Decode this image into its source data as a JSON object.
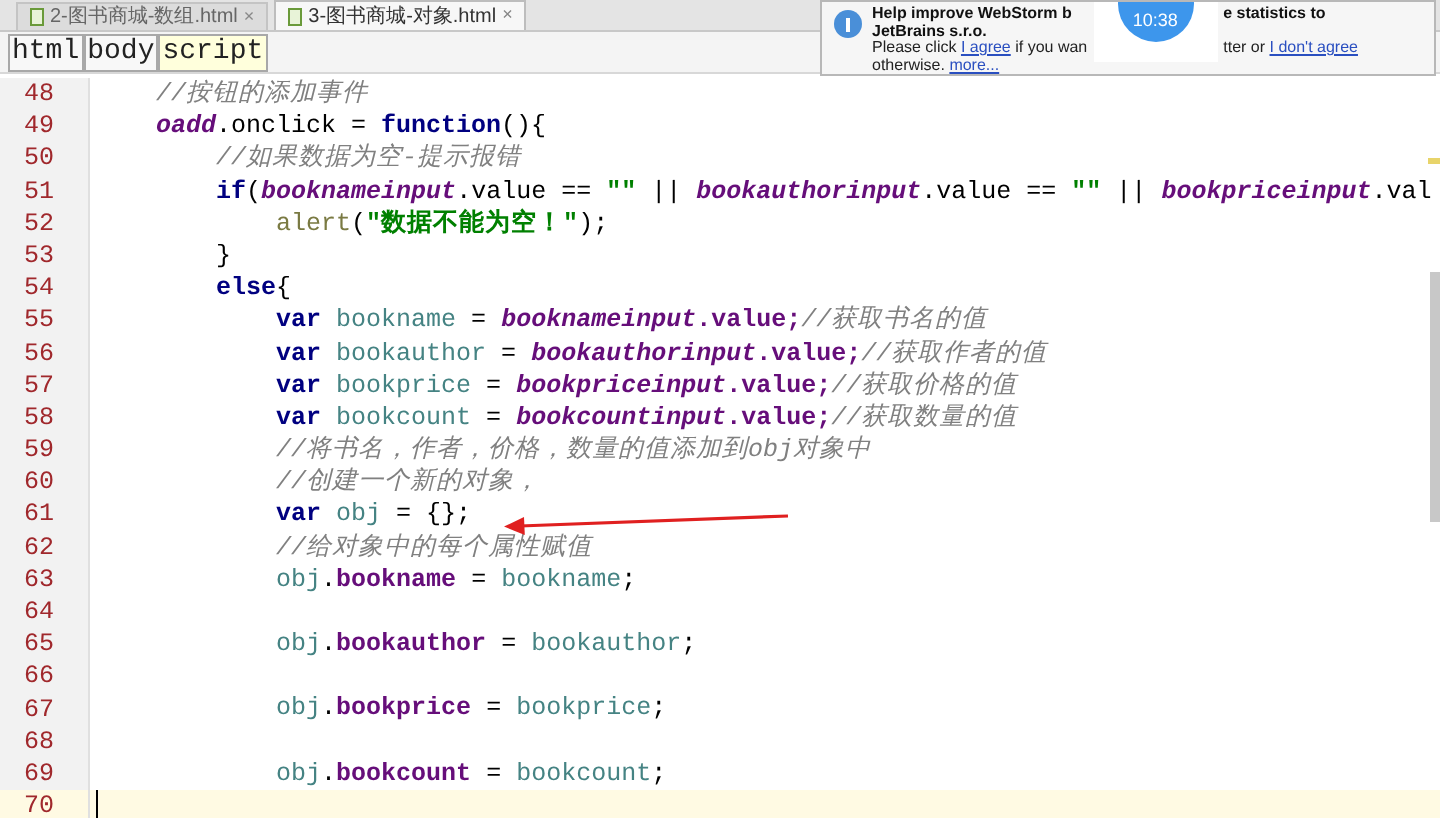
{
  "tabs": [
    {
      "label": "2-图书商城-数组.html",
      "close": "×",
      "selected": false
    },
    {
      "label": "3-图书商城-对象.html",
      "close": "×",
      "selected": true
    }
  ],
  "breadcrumb": [
    {
      "label": "html",
      "selected": false
    },
    {
      "label": "body",
      "selected": false
    },
    {
      "label": "script",
      "selected": true
    }
  ],
  "notification": {
    "left_lines": [
      [
        {
          "kind": "bold",
          "text": "Help improve WebStorm b"
        }
      ],
      [
        {
          "kind": "bold",
          "text": "JetBrains s.r.o."
        }
      ],
      [
        {
          "kind": "text",
          "text": "Please click "
        },
        {
          "kind": "link",
          "text": "I agree"
        },
        {
          "kind": "text",
          "text": " if you wan"
        }
      ],
      [
        {
          "kind": "text",
          "text": "otherwise. "
        },
        {
          "kind": "link",
          "text": "more..."
        }
      ]
    ],
    "right_lines": [
      [
        {
          "kind": "bold",
          "text": "e statistics to"
        }
      ],
      [
        {
          "kind": "text",
          "text": "tter or "
        },
        {
          "kind": "link",
          "text": "I don't agree"
        }
      ]
    ]
  },
  "clock": {
    "time": "10:38"
  },
  "editor": {
    "lines": [
      {
        "number": "48",
        "current": false,
        "tokens": [
          {
            "kind": "comment",
            "text": "    //按钮的添加事件"
          }
        ]
      },
      {
        "number": "49",
        "current": false,
        "tokens": [
          {
            "kind": "field",
            "text": "    oadd"
          },
          {
            "kind": "plain",
            "text": ".onclick = "
          },
          {
            "kind": "kw",
            "text": "function"
          },
          {
            "kind": "plain",
            "text": "(){"
          }
        ]
      },
      {
        "number": "50",
        "current": false,
        "tokens": [
          {
            "kind": "comment",
            "text": "        //如果数据为空-提示报错"
          }
        ]
      },
      {
        "number": "51",
        "current": false,
        "tokens": [
          {
            "kind": "kw",
            "text": "        if"
          },
          {
            "kind": "plain",
            "text": "("
          },
          {
            "kind": "field",
            "text": "booknameinput"
          },
          {
            "kind": "plain",
            "text": ".value == "
          },
          {
            "kind": "str",
            "text": "\"\""
          },
          {
            "kind": "plain",
            "text": " || "
          },
          {
            "kind": "field",
            "text": "bookauthorinput"
          },
          {
            "kind": "plain",
            "text": ".value == "
          },
          {
            "kind": "str",
            "text": "\"\""
          },
          {
            "kind": "plain",
            "text": " || "
          },
          {
            "kind": "field",
            "text": "bookpriceinput"
          },
          {
            "kind": "plain",
            "text": ".val"
          }
        ]
      },
      {
        "number": "52",
        "current": false,
        "tokens": [
          {
            "kind": "fn",
            "text": "            alert"
          },
          {
            "kind": "plain",
            "text": "("
          },
          {
            "kind": "str",
            "text": "\"数据不能为空！\""
          },
          {
            "kind": "plain",
            "text": ");"
          }
        ]
      },
      {
        "number": "53",
        "current": false,
        "tokens": [
          {
            "kind": "plain",
            "text": "        }"
          }
        ]
      },
      {
        "number": "54",
        "current": false,
        "tokens": [
          {
            "kind": "kw",
            "text": "        else"
          },
          {
            "kind": "plain",
            "text": "{"
          }
        ]
      },
      {
        "number": "55",
        "current": false,
        "tokens": [
          {
            "kind": "kw",
            "text": "            var "
          },
          {
            "kind": "local",
            "text": "bookname"
          },
          {
            "kind": "plain",
            "text": " = "
          },
          {
            "kind": "field",
            "text": "booknameinput"
          },
          {
            "kind": "prop",
            "text": ".value;"
          },
          {
            "kind": "comment",
            "text": "//获取书名的值"
          }
        ]
      },
      {
        "number": "56",
        "current": false,
        "tokens": [
          {
            "kind": "kw",
            "text": "            var "
          },
          {
            "kind": "local",
            "text": "bookauthor"
          },
          {
            "kind": "plain",
            "text": " = "
          },
          {
            "kind": "field",
            "text": "bookauthorinput"
          },
          {
            "kind": "prop",
            "text": ".value;"
          },
          {
            "kind": "comment",
            "text": "//获取作者的值"
          }
        ]
      },
      {
        "number": "57",
        "current": false,
        "tokens": [
          {
            "kind": "kw",
            "text": "            var "
          },
          {
            "kind": "local",
            "text": "bookprice"
          },
          {
            "kind": "plain",
            "text": " = "
          },
          {
            "kind": "field",
            "text": "bookpriceinput"
          },
          {
            "kind": "prop",
            "text": ".value;"
          },
          {
            "kind": "comment",
            "text": "//获取价格的值"
          }
        ]
      },
      {
        "number": "58",
        "current": false,
        "tokens": [
          {
            "kind": "kw",
            "text": "            var "
          },
          {
            "kind": "local",
            "text": "bookcount"
          },
          {
            "kind": "plain",
            "text": " = "
          },
          {
            "kind": "field",
            "text": "bookcountinput"
          },
          {
            "kind": "prop",
            "text": ".value;"
          },
          {
            "kind": "comment",
            "text": "//获取数量的值"
          }
        ]
      },
      {
        "number": "59",
        "current": false,
        "tokens": [
          {
            "kind": "comment",
            "text": "            //将书名，作者，价格，数量的值添加到obj对象中"
          }
        ]
      },
      {
        "number": "60",
        "current": false,
        "tokens": [
          {
            "kind": "comment",
            "text": "            //创建一个新的对象，"
          }
        ]
      },
      {
        "number": "61",
        "current": false,
        "tokens": [
          {
            "kind": "kw",
            "text": "            var "
          },
          {
            "kind": "local",
            "text": "obj"
          },
          {
            "kind": "plain",
            "text": " = {};"
          }
        ]
      },
      {
        "number": "62",
        "current": false,
        "tokens": [
          {
            "kind": "comment",
            "text": "            //给对象中的每个属性赋值"
          }
        ]
      },
      {
        "number": "63",
        "current": false,
        "tokens": [
          {
            "kind": "local",
            "text": "            obj"
          },
          {
            "kind": "plain",
            "text": "."
          },
          {
            "kind": "prop",
            "text": "bookname"
          },
          {
            "kind": "plain",
            "text": " = "
          },
          {
            "kind": "local",
            "text": "bookname"
          },
          {
            "kind": "plain",
            "text": ";"
          }
        ]
      },
      {
        "number": "64",
        "current": false
      },
      {
        "number": "65",
        "current": false,
        "tokens": [
          {
            "kind": "local",
            "text": "            obj"
          },
          {
            "kind": "plain",
            "text": "."
          },
          {
            "kind": "prop",
            "text": "bookauthor"
          },
          {
            "kind": "plain",
            "text": " = "
          },
          {
            "kind": "local",
            "text": "bookauthor"
          },
          {
            "kind": "plain",
            "text": ";"
          }
        ]
      },
      {
        "number": "66",
        "current": false
      },
      {
        "number": "67",
        "current": false,
        "tokens": [
          {
            "kind": "local",
            "text": "            obj"
          },
          {
            "kind": "plain",
            "text": "."
          },
          {
            "kind": "prop",
            "text": "bookprice"
          },
          {
            "kind": "plain",
            "text": " = "
          },
          {
            "kind": "local",
            "text": "bookprice"
          },
          {
            "kind": "plain",
            "text": ";"
          }
        ]
      },
      {
        "number": "68",
        "current": false
      },
      {
        "number": "69",
        "current": false,
        "tokens": [
          {
            "kind": "local",
            "text": "            obj"
          },
          {
            "kind": "plain",
            "text": "."
          },
          {
            "kind": "prop",
            "text": "bookcount"
          },
          {
            "kind": "plain",
            "text": " = "
          },
          {
            "kind": "local",
            "text": "bookcount"
          },
          {
            "kind": "plain",
            "text": ";"
          }
        ]
      },
      {
        "number": "70",
        "current": true
      }
    ]
  }
}
